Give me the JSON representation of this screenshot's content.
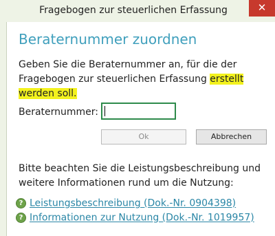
{
  "window": {
    "title": "Fragebogen zur steuerlichen Erfassung",
    "close_glyph": "✕"
  },
  "dialog": {
    "heading": "Beraternummer zuordnen",
    "intro_plain": "Geben Sie die Beraternummer an, für die der Fragebogen zur steuerlichen Erfassung ",
    "intro_highlight_1": "erstellt",
    "intro_highlight_2": "werden soll.",
    "field_label": "Beraternummer:",
    "field_value": "",
    "ok_label": "Ok",
    "cancel_label": "Abbrechen",
    "note": "Bitte beachten Sie die Leistungsbeschreibung und weitere Informationen rund um die Nutzung:",
    "links": [
      {
        "label": "Leistungsbeschreibung (Dok.-Nr. 0904398)",
        "icon": "help-icon",
        "icon_glyph": "?"
      },
      {
        "label": "Informationen zur Nutzung (Dok.-Nr. 1019957)",
        "icon": "help-icon",
        "icon_glyph": "?"
      }
    ]
  }
}
